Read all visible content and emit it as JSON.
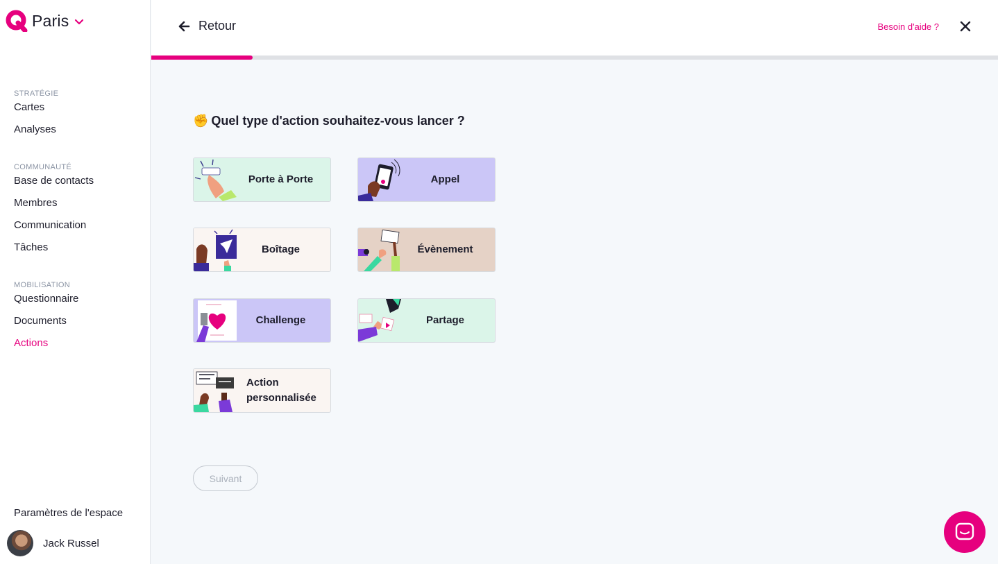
{
  "workspace": {
    "name": "Paris"
  },
  "sidebar": {
    "sections": [
      {
        "heading": "STRATÉGIE",
        "items": [
          "Cartes",
          "Analyses"
        ]
      },
      {
        "heading": "COMMUNAUTÉ",
        "items": [
          "Base de contacts",
          "Membres",
          "Communication",
          "Tâches"
        ]
      },
      {
        "heading": "MOBILISATION",
        "items": [
          "Questionnaire",
          "Documents",
          "Actions"
        ]
      }
    ],
    "active_item": "Actions",
    "settings_label": "Paramètres de l'espace",
    "user_name": "Jack Russel"
  },
  "header": {
    "back_label": "Retour",
    "help_label": "Besoin d'aide ?"
  },
  "progress": {
    "fraction": 0.12
  },
  "question": {
    "emoji": "✊",
    "text": "Quel type d'action souhaitez-vous lancer ?"
  },
  "action_types": [
    {
      "id": "porte-a-porte",
      "label": "Porte à Porte",
      "color": "#dbf5e9"
    },
    {
      "id": "appel",
      "label": "Appel",
      "color": "#cbc6f7"
    },
    {
      "id": "boitage",
      "label": "Boîtage",
      "color": "#faf5f2"
    },
    {
      "id": "evenement",
      "label": "Évènement",
      "color": "#e5d2c6"
    },
    {
      "id": "challenge",
      "label": "Challenge",
      "color": "#cbc6f7"
    },
    {
      "id": "partage",
      "label": "Partage",
      "color": "#dbf5e9"
    },
    {
      "id": "action-personnalisee",
      "label": "Action personnalisée",
      "color": "#faf5f2"
    }
  ],
  "next_button": {
    "label": "Suivant"
  },
  "colors": {
    "accent": "#e6007e"
  }
}
